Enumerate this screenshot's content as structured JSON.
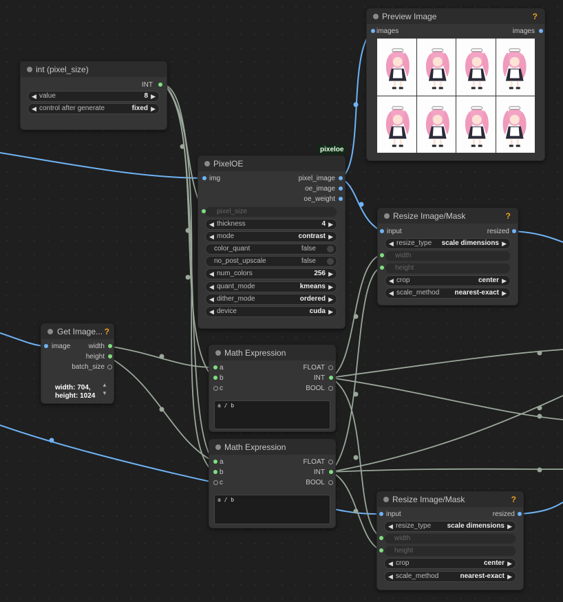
{
  "canvas": {
    "background": "#1f1f1f",
    "grid_dot": "#2c2c2c"
  },
  "colors": {
    "image_wire": "#6fb4f7",
    "int_wire": "#9aa89a",
    "help": "#f0a020",
    "node_bg": "#353535"
  },
  "int_node": {
    "title": "int (pixel_size)",
    "output": "INT",
    "widgets": [
      {
        "label": "value",
        "value": "8"
      },
      {
        "label": "control after generate",
        "value": "fixed"
      }
    ]
  },
  "preview_node": {
    "title": "Preview Image",
    "help": "?",
    "input": "images",
    "output": "images",
    "thumbnail_count": 8
  },
  "pixeloe_badge": "pixeloe",
  "pixeloe_node": {
    "title": "PixelOE",
    "input": "img",
    "outputs": [
      "pixel_image",
      "oe_image",
      "oe_weight"
    ],
    "converted_input": "pixel_size",
    "widgets": [
      {
        "label": "thickness",
        "value": "4",
        "kind": "number"
      },
      {
        "label": "mode",
        "value": "contrast",
        "kind": "combo"
      },
      {
        "label": "color_quant",
        "value": "false",
        "kind": "toggle"
      },
      {
        "label": "no_post_upscale",
        "value": "false",
        "kind": "toggle"
      },
      {
        "label": "num_colors",
        "value": "256",
        "kind": "number"
      },
      {
        "label": "quant_mode",
        "value": "kmeans",
        "kind": "combo"
      },
      {
        "label": "dither_mode",
        "value": "ordered",
        "kind": "combo"
      },
      {
        "label": "device",
        "value": "cuda",
        "kind": "combo"
      }
    ]
  },
  "resize_node_1": {
    "title": "Resize Image/Mask",
    "help": "?",
    "input": "input",
    "output": "resized",
    "widgets": [
      {
        "label": "resize_type",
        "value": "scale dimensions"
      },
      {
        "label": "width",
        "value": "",
        "disabled": true
      },
      {
        "label": "height",
        "value": "",
        "disabled": true
      },
      {
        "label": "crop",
        "value": "center"
      },
      {
        "label": "scale_method",
        "value": "nearest-exact"
      }
    ]
  },
  "get_image_node": {
    "title": "Get Image...",
    "help": "?",
    "input": "image",
    "outputs": [
      "width",
      "height",
      "batch_size"
    ],
    "info_line1": "width: 704,",
    "info_line2": "height: 1024",
    "stepper_up": "▲",
    "stepper_down": "▼"
  },
  "math_node_1": {
    "title": "Math Expression",
    "inputs": [
      "a",
      "b",
      "c"
    ],
    "outputs": [
      "FLOAT",
      "INT",
      "BOOL"
    ],
    "expression": "a / b"
  },
  "math_node_2": {
    "title": "Math Expression",
    "inputs": [
      "a",
      "b",
      "c"
    ],
    "outputs": [
      "FLOAT",
      "INT",
      "BOOL"
    ],
    "expression": "a / b"
  },
  "resize_node_2": {
    "title": "Resize Image/Mask",
    "help": "?",
    "input": "input",
    "output": "resized",
    "widgets": [
      {
        "label": "resize_type",
        "value": "scale dimensions"
      },
      {
        "label": "width",
        "value": "",
        "disabled": true
      },
      {
        "label": "height",
        "value": "",
        "disabled": true
      },
      {
        "label": "crop",
        "value": "center"
      },
      {
        "label": "scale_method",
        "value": "nearest-exact"
      }
    ]
  }
}
